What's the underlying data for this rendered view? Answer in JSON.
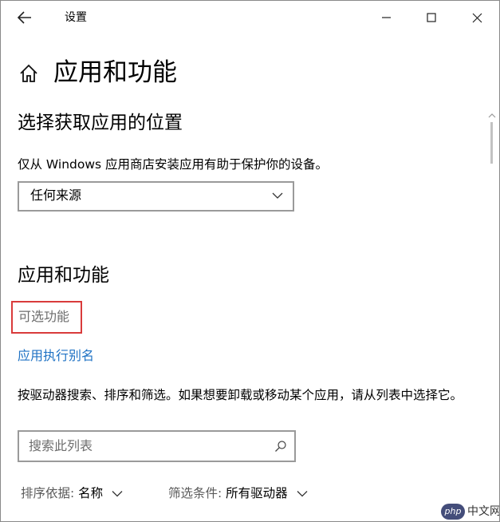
{
  "window": {
    "title": "设置",
    "icons": {
      "back": "back-arrow-icon",
      "minimize": "minimize-icon",
      "maximize": "maximize-icon",
      "close": "close-icon"
    }
  },
  "header": {
    "icon": "home-icon",
    "title": "应用和功能"
  },
  "app_source": {
    "heading": "选择获取应用的位置",
    "description": "仅从 Windows 应用商店安装应用有助于保护你的设备。",
    "dropdown_value": "任何来源"
  },
  "apps_features": {
    "heading": "应用和功能",
    "optional_features_link": "可选功能",
    "app_alias_link": "应用执行别名",
    "description": "按驱动器搜索、排序和筛选。如果想要卸载或移动某个应用，请从列表中选择它。",
    "search_placeholder": "搜索此列表",
    "sort_prefix": "排序依据:",
    "sort_value": "名称",
    "filter_prefix": "筛选条件:",
    "filter_value": "所有驱动器"
  },
  "watermark": {
    "badge": "php",
    "text": "中文网"
  },
  "colors": {
    "link": "#1f72c4",
    "highlight_border": "#d93b3b",
    "secondary_text": "#6d6d6d",
    "control_border": "#9a9a9a"
  }
}
